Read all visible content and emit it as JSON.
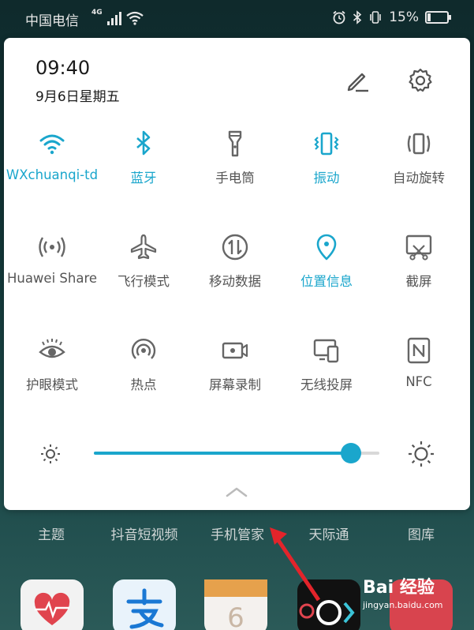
{
  "status_bar": {
    "carrier": "中国电信",
    "network": "4G",
    "battery": "15%"
  },
  "panel": {
    "time": "09:40",
    "date": "9月6日星期五"
  },
  "tiles": [
    {
      "label": "WXchuanqi-td",
      "icon": "wifi-icon",
      "active": true
    },
    {
      "label": "蓝牙",
      "icon": "bluetooth-icon",
      "active": true
    },
    {
      "label": "手电筒",
      "icon": "flashlight-icon",
      "active": false
    },
    {
      "label": "振动",
      "icon": "vibrate-icon",
      "active": true
    },
    {
      "label": "自动旋转",
      "icon": "auto-rotate-icon",
      "active": false
    },
    {
      "label": "Huawei Share",
      "icon": "huawei-share-icon",
      "active": false
    },
    {
      "label": "飞行模式",
      "icon": "airplane-icon",
      "active": false
    },
    {
      "label": "移动数据",
      "icon": "mobile-data-icon",
      "active": false
    },
    {
      "label": "位置信息",
      "icon": "location-icon",
      "active": true
    },
    {
      "label": "截屏",
      "icon": "screenshot-icon",
      "active": false
    },
    {
      "label": "护眼模式",
      "icon": "eye-icon",
      "active": false
    },
    {
      "label": "热点",
      "icon": "hotspot-icon",
      "active": false
    },
    {
      "label": "屏幕录制",
      "icon": "screen-record-icon",
      "active": false
    },
    {
      "label": "无线投屏",
      "icon": "wireless-projection-icon",
      "active": false
    },
    {
      "label": "NFC",
      "icon": "nfc-icon",
      "active": false
    }
  ],
  "brightness": {
    "level": 0.9
  },
  "home_apps": [
    "主题",
    "抖音短视频",
    "手机管家",
    "天际通",
    "图库"
  ],
  "watermark": {
    "brand": "Bai 经验",
    "url": "jingyan.baidu.com"
  },
  "colors": {
    "accent": "#1aa6cc",
    "inactive_icon": "#666666",
    "panel_bg": "#ffffff"
  }
}
